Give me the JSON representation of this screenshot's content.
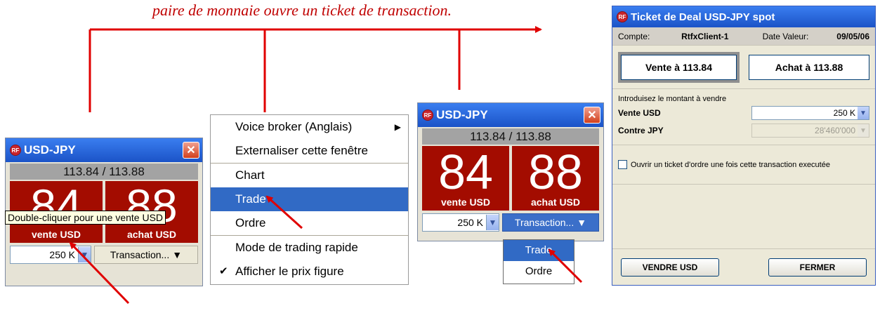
{
  "caption": "paire de monnaie ouvre un ticket de transaction.",
  "widget1": {
    "title": "USD-JPY",
    "logo": "RF",
    "close": "✕",
    "price": "113.84 / 113.88",
    "sell_big": "84",
    "buy_big": "88",
    "sell_label": "vente USD",
    "buy_label": "achat USD",
    "amount": "250 K",
    "transaction": "Transaction...",
    "tooltip": "Double-cliquer pour une vente USD"
  },
  "widget2": {
    "title": "USD-JPY",
    "logo": "RF",
    "close": "✕",
    "price": "113.84 / 113.88",
    "sell_big": "84",
    "buy_big": "88",
    "sell_label": "vente USD",
    "buy_label": "achat USD",
    "amount": "250 K",
    "transaction": "Transaction..."
  },
  "context_menu": {
    "items": [
      "Voice broker (Anglais)",
      "Externaliser cette fenêtre",
      "Chart",
      "Trade",
      "Ordre",
      "Mode de trading rapide",
      "Afficher le prix figure"
    ],
    "selected": "Trade"
  },
  "small_menu": {
    "items": [
      "Trade",
      "Ordre"
    ]
  },
  "ticket": {
    "title": "Ticket de Deal USD-JPY spot",
    "logo": "RF",
    "account_label": "Compte:",
    "account_value": "RtfxClient-1",
    "value_date_label": "Date Valeur:",
    "value_date": "09/05/06",
    "sell_button": "Vente à 113.84",
    "buy_button": "Achat à 113.88",
    "instruction": "Introduisez le montant à vendre",
    "sell_field_label": "Vente USD",
    "sell_field_value": "250 K",
    "counter_field_label": "Contre JPY",
    "counter_field_value": "28'460'000",
    "checkbox_label": "Ouvrir un ticket d'ordre une fois cette transaction executée",
    "sell_action": "VENDRE USD",
    "close_action": "FERMER"
  },
  "colors": {
    "annotation": "#e00000",
    "tile": "#a30c00",
    "selection": "#316ac5",
    "titlebar": "#1b53c7"
  }
}
